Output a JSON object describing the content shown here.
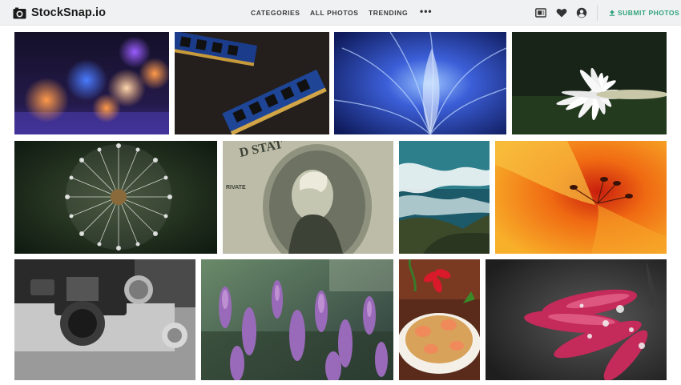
{
  "header": {
    "logo_text": "StockSnap.io",
    "nav": [
      "CATEGORIES",
      "ALL PHOTOS",
      "TRENDING"
    ],
    "more_label": "•••",
    "icons": [
      "collection-icon",
      "heart-icon",
      "user-icon"
    ],
    "submit_label": "SUBMIT PHOTOS",
    "accent": "#2fa37a"
  },
  "photos": [
    {
      "subject": "bokeh lights"
    },
    {
      "subject": "ram memory modules"
    },
    {
      "subject": "blue abstract light"
    },
    {
      "subject": "white daisy"
    },
    {
      "subject": "dandelion seed head"
    },
    {
      "subject": "dollar bill portrait"
    },
    {
      "subject": "ocean waves coastline"
    },
    {
      "subject": "orange lily close-up"
    },
    {
      "subject": "vintage camera"
    },
    {
      "subject": "purple heather flowers"
    },
    {
      "subject": "shrimp noodle dish"
    },
    {
      "subject": "pink flower with dew drops"
    }
  ]
}
